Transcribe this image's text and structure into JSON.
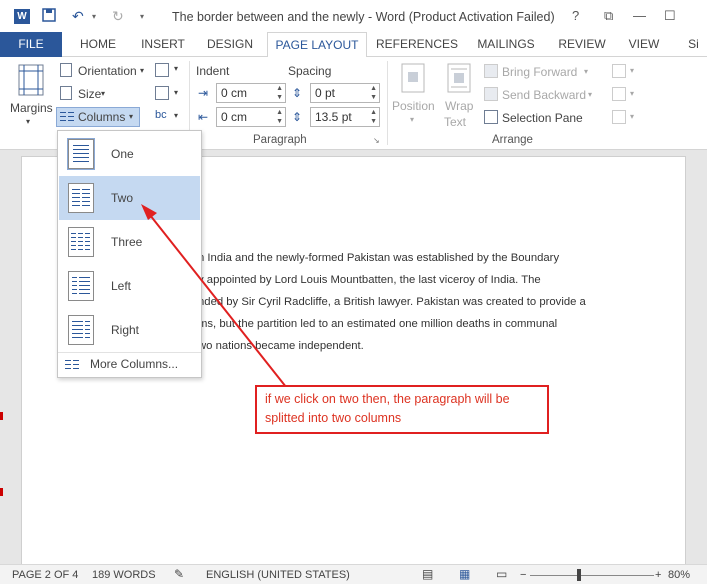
{
  "titlebar": {
    "app_logo": "W",
    "title": "The border between and the newly - Word (Product Activation Failed)",
    "controls": [
      "?",
      "⧉",
      "—",
      "☐"
    ]
  },
  "tabs": [
    "FILE",
    "HOME",
    "INSERT",
    "DESIGN",
    "PAGE LAYOUT",
    "REFERENCES",
    "MAILINGS",
    "REVIEW",
    "VIEW",
    "Si"
  ],
  "active_tab": "PAGE LAYOUT",
  "ribbon": {
    "margins": "Margins",
    "orientation": "Orientation",
    "size": "Size",
    "columns": "Columns",
    "paragraph_group": "Paragraph",
    "indent_label": "Indent",
    "spacing_label": "Spacing",
    "indent_left": "0 cm",
    "indent_right": "0 cm",
    "spacing_before": "0 pt",
    "spacing_after": "13.5 pt",
    "position": "Position",
    "wrap_text_1": "Wrap",
    "wrap_text_2": "Text",
    "bring_forward": "Bring Forward",
    "send_backward": "Send Backward",
    "selection_pane": "Selection Pane",
    "arrange_group": "Arrange"
  },
  "columns_menu": {
    "items": [
      "One",
      "Two",
      "Three",
      "Left",
      "Right"
    ],
    "highlighted": "Two",
    "more": "More Columns..."
  },
  "document": {
    "paragraph": "n India and the newly-formed Pakistan was established by the Boundary y appointed by Lord Louis Mountbatten, the last viceroy of India. The nded by Sir Cyril Radcliffe, a British lawyer. Pakistan was created to provide a ms, but the partition led to an estimated one million deaths in communal wo nations became independent.",
    "lines": [
      "n India and the newly-formed Pakistan was established by the Boundary",
      "y appointed by Lord Louis Mountbatten, the last viceroy of India. The",
      "nded by Sir Cyril Radcliffe, a British lawyer. Pakistan was created to provide a",
      "ms, but the partition led to an estimated one million deaths in communal",
      "wo nations became independent."
    ]
  },
  "annotation": {
    "text": "if we click on two then, the paragraph will be splitted into two columns",
    "color": "#e02020"
  },
  "statusbar": {
    "page": "PAGE 2 OF 4",
    "words": "189 WORDS",
    "language": "ENGLISH (UNITED STATES)",
    "zoom": "80%",
    "zoom_minus": "−",
    "zoom_plus": "+"
  },
  "colors": {
    "accent": "#2b579a",
    "menu_highlight": "#c5d9f1",
    "annotation": "#e02020"
  }
}
